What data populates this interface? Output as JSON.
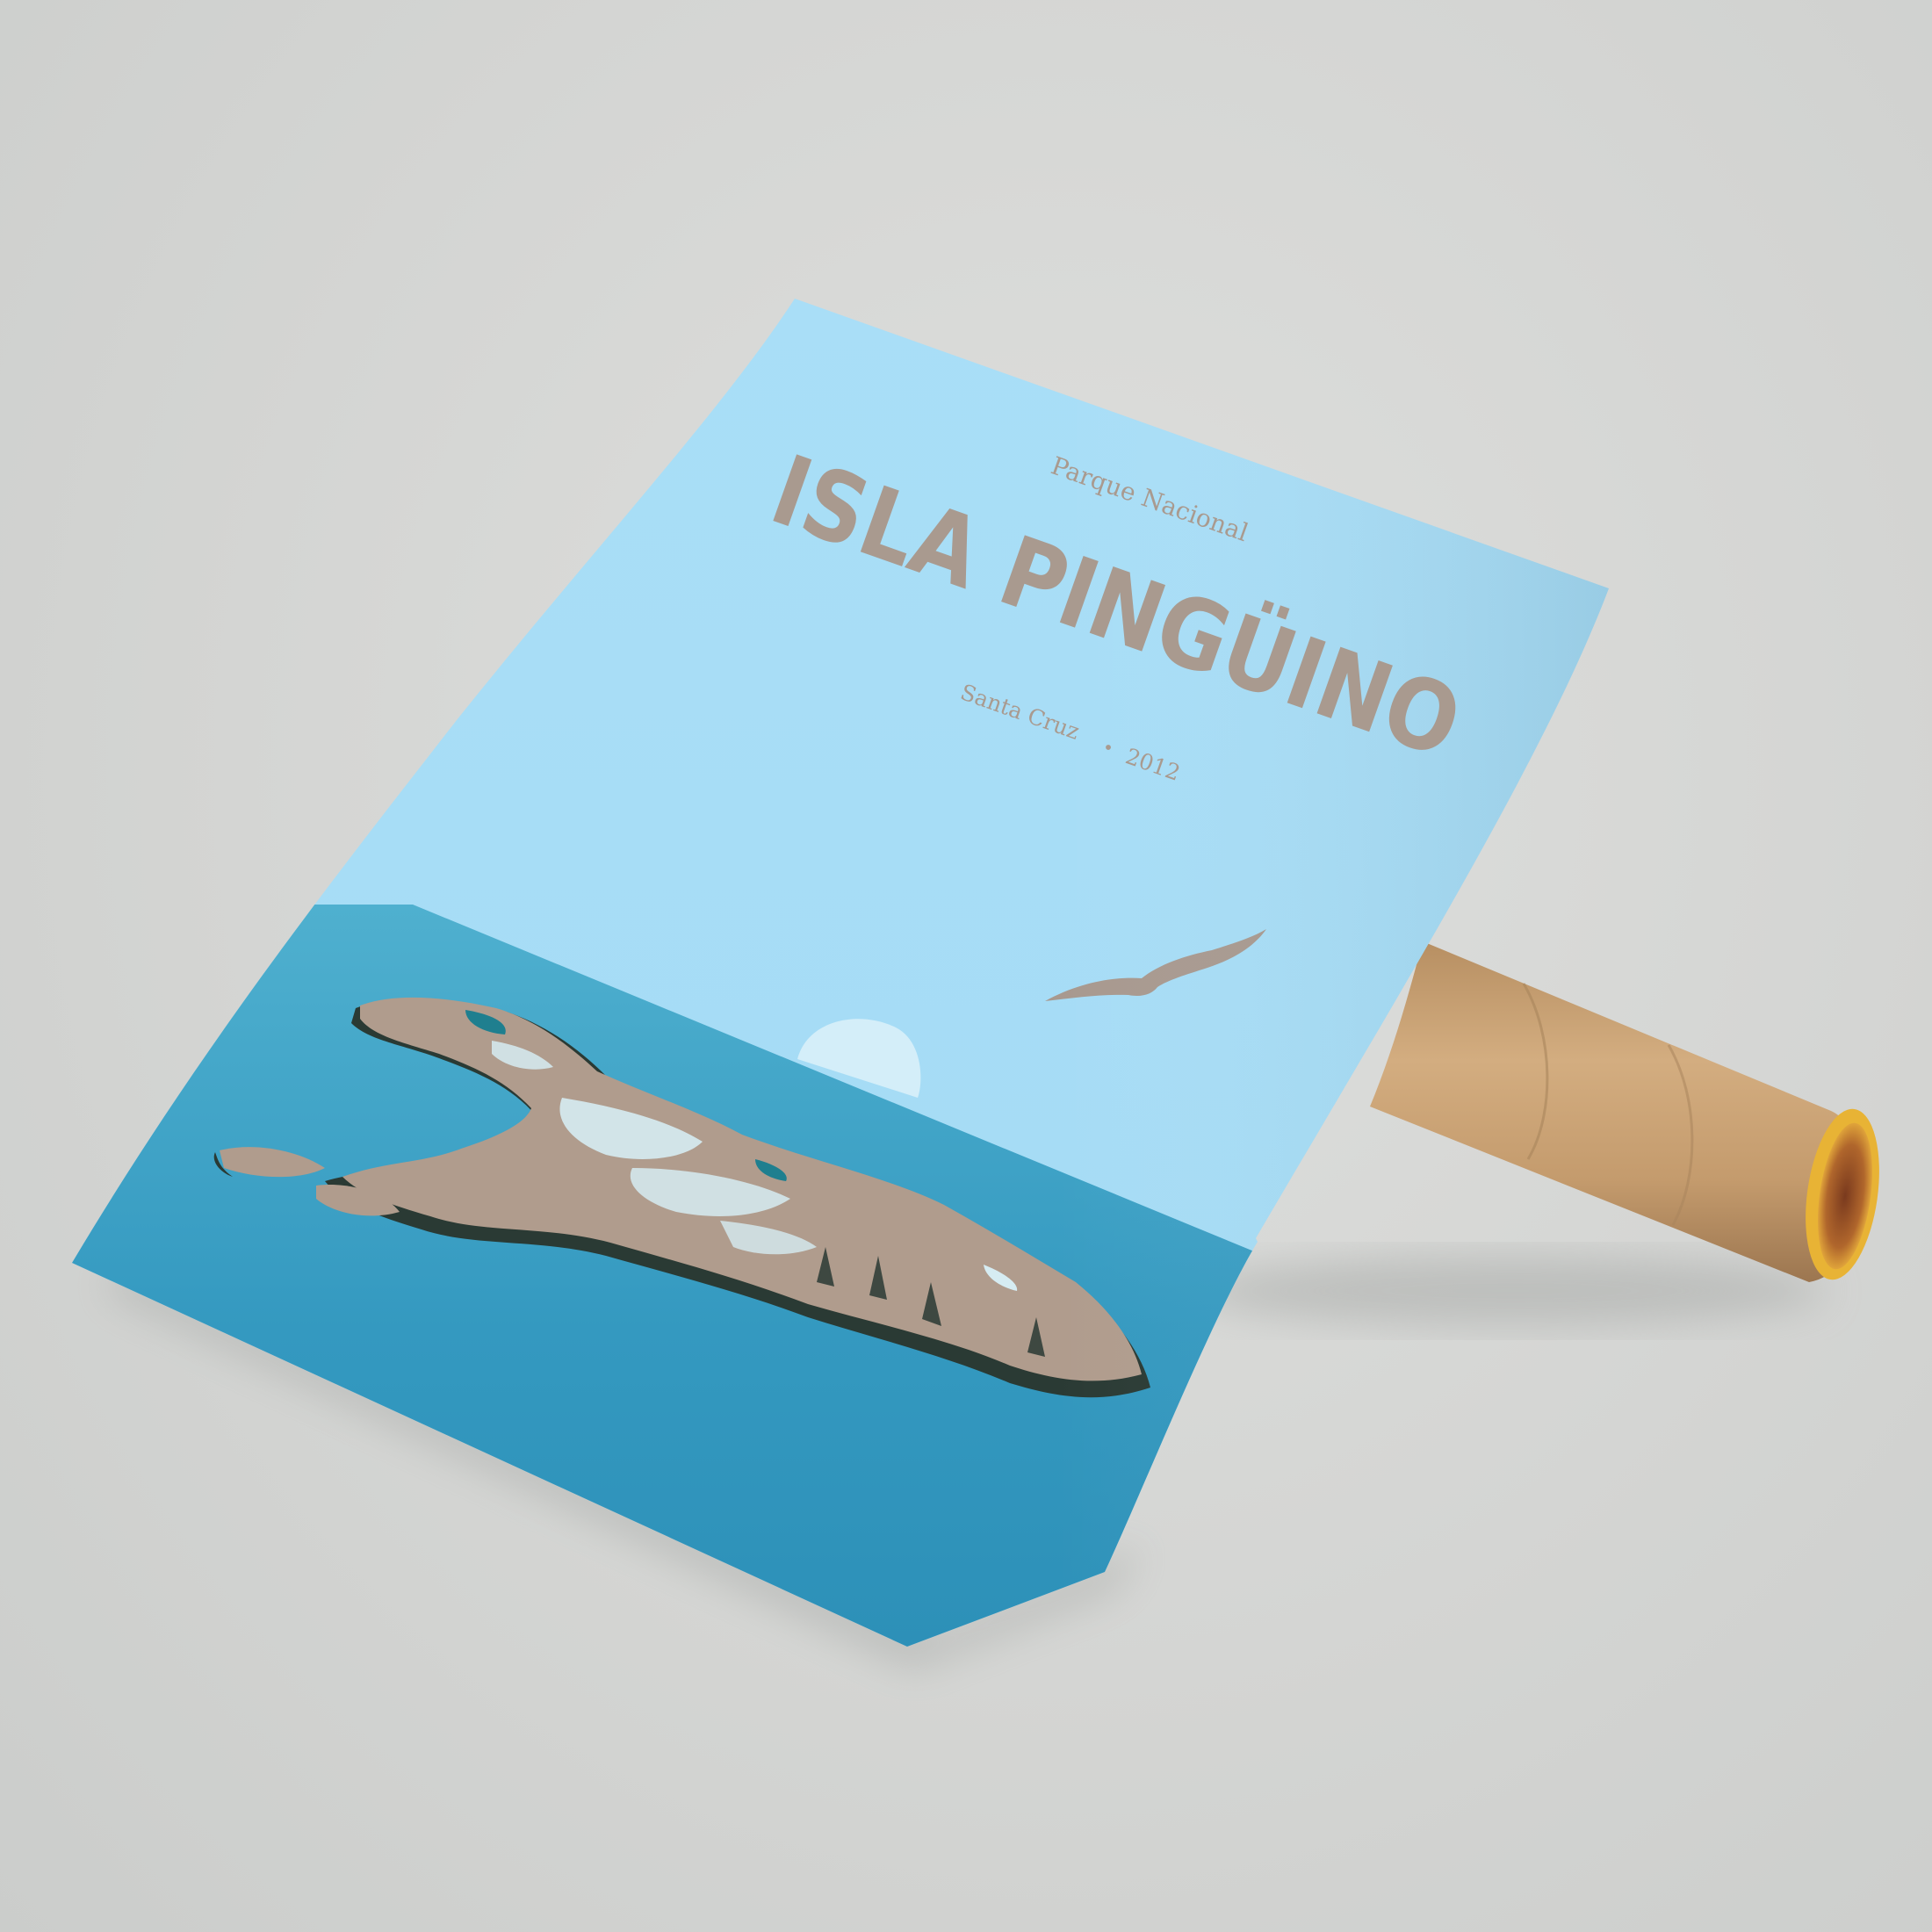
{
  "poster": {
    "subtitle_top": "Parque Nacional",
    "title": "ISLA PINGÜINO",
    "location": "Santa Cruz",
    "separator": "•",
    "year": "2012"
  },
  "colors": {
    "background": "#d5d6d4",
    "sky": "#a8def6",
    "sea_far": "#4facca",
    "sea_near": "#2a8fb6",
    "land": "#b09c8d",
    "text": "#a99a8f",
    "tube": "#c9a274",
    "tube_rim": "#f0b830"
  },
  "icons": {
    "bird": "seabird-silhouette",
    "sun": "setting-sun",
    "tube": "cardboard-mailing-tube"
  }
}
